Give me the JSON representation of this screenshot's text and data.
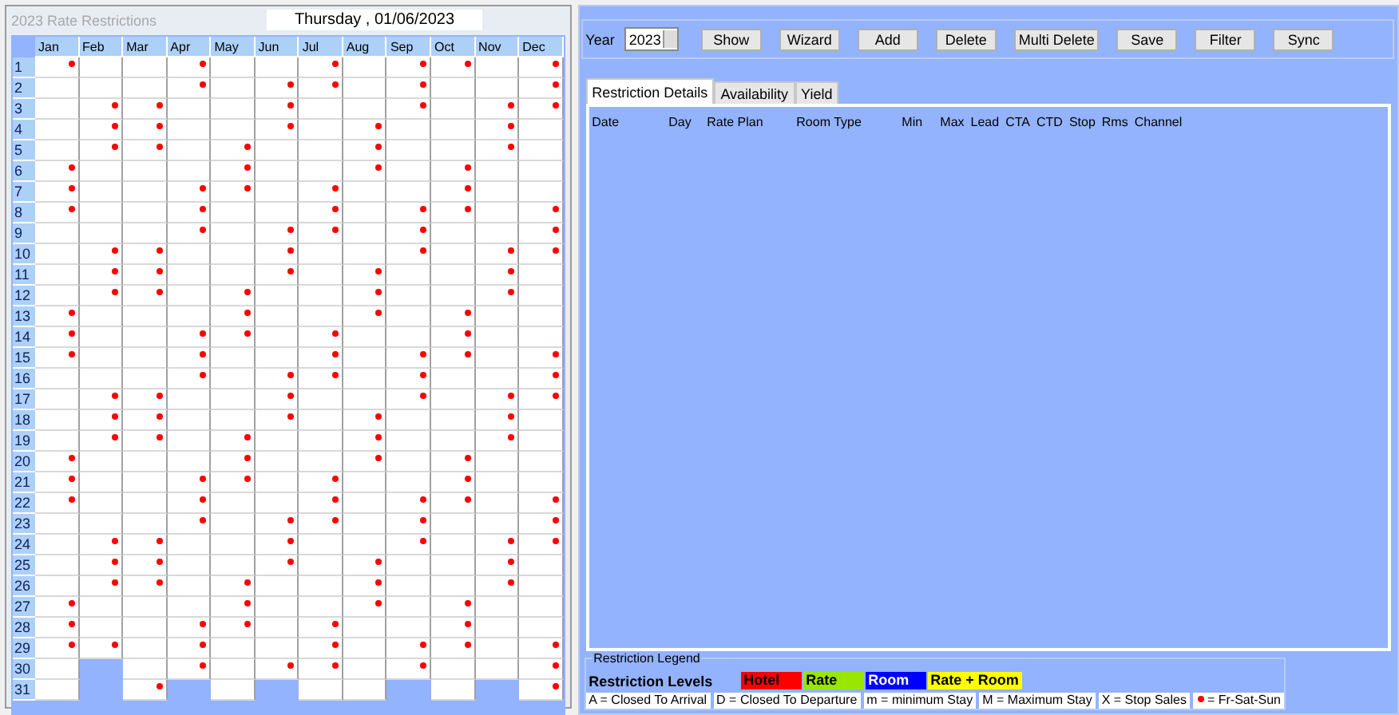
{
  "calendar": {
    "title": "2023 Rate Restrictions",
    "date": "Thursday , 01/06/2023",
    "months": [
      {
        "label": "Jan",
        "dots": [
          true,
          false,
          false,
          false,
          false,
          true,
          true,
          true,
          false,
          false,
          false,
          false,
          true,
          true,
          true,
          false,
          false,
          false,
          false,
          true,
          true,
          true,
          false,
          false,
          false,
          false,
          true,
          true,
          true,
          false,
          false
        ]
      },
      {
        "label": "Feb",
        "dots": [
          false,
          false,
          true,
          true,
          true,
          false,
          false,
          false,
          false,
          true,
          true,
          true,
          false,
          false,
          false,
          false,
          true,
          true,
          true,
          false,
          false,
          false,
          false,
          true,
          true,
          true,
          false,
          false,
          true
        ]
      },
      {
        "label": "Mar",
        "dots": [
          false,
          false,
          true,
          true,
          true,
          false,
          false,
          false,
          false,
          true,
          true,
          true,
          false,
          false,
          false,
          false,
          true,
          true,
          true,
          false,
          false,
          false,
          false,
          true,
          true,
          true,
          false,
          false,
          false,
          false,
          true
        ]
      },
      {
        "label": "Apr",
        "dots": [
          true,
          true,
          false,
          false,
          false,
          false,
          true,
          true,
          true,
          false,
          false,
          false,
          false,
          true,
          true,
          true,
          false,
          false,
          false,
          false,
          true,
          true,
          true,
          false,
          false,
          false,
          false,
          true,
          true,
          true
        ]
      },
      {
        "label": "May",
        "dots": [
          false,
          false,
          false,
          false,
          true,
          true,
          true,
          false,
          false,
          false,
          false,
          true,
          true,
          true,
          false,
          false,
          false,
          false,
          true,
          true,
          true,
          false,
          false,
          false,
          false,
          true,
          true,
          true,
          false,
          false,
          false
        ]
      },
      {
        "label": "Jun",
        "dots": [
          false,
          true,
          true,
          true,
          false,
          false,
          false,
          false,
          true,
          true,
          true,
          false,
          false,
          false,
          false,
          true,
          true,
          true,
          false,
          false,
          false,
          false,
          true,
          true,
          true,
          false,
          false,
          false,
          false,
          true
        ]
      },
      {
        "label": "Jul",
        "dots": [
          true,
          true,
          false,
          false,
          false,
          false,
          true,
          true,
          true,
          false,
          false,
          false,
          false,
          true,
          true,
          true,
          false,
          false,
          false,
          false,
          true,
          true,
          true,
          false,
          false,
          false,
          false,
          true,
          true,
          true,
          false
        ]
      },
      {
        "label": "Aug",
        "dots": [
          false,
          false,
          false,
          true,
          true,
          true,
          false,
          false,
          false,
          false,
          true,
          true,
          true,
          false,
          false,
          false,
          false,
          true,
          true,
          true,
          false,
          false,
          false,
          false,
          true,
          true,
          true,
          false,
          false,
          false,
          false
        ]
      },
      {
        "label": "Sep",
        "dots": [
          true,
          true,
          true,
          false,
          false,
          false,
          false,
          true,
          true,
          true,
          false,
          false,
          false,
          false,
          true,
          true,
          true,
          false,
          false,
          false,
          false,
          true,
          true,
          true,
          false,
          false,
          false,
          false,
          true,
          true
        ]
      },
      {
        "label": "Oct",
        "dots": [
          true,
          false,
          false,
          false,
          false,
          true,
          true,
          true,
          false,
          false,
          false,
          false,
          true,
          true,
          true,
          false,
          false,
          false,
          false,
          true,
          true,
          true,
          false,
          false,
          false,
          false,
          true,
          true,
          true,
          false,
          false
        ]
      },
      {
        "label": "Nov",
        "dots": [
          false,
          false,
          true,
          true,
          true,
          false,
          false,
          false,
          false,
          true,
          true,
          true,
          false,
          false,
          false,
          false,
          true,
          true,
          true,
          false,
          false,
          false,
          false,
          true,
          true,
          true,
          false,
          false,
          false,
          false
        ]
      },
      {
        "label": "Dec",
        "dots": [
          true,
          true,
          true,
          false,
          false,
          false,
          false,
          true,
          true,
          true,
          false,
          false,
          false,
          false,
          true,
          true,
          true,
          false,
          false,
          false,
          false,
          true,
          true,
          true,
          false,
          false,
          false,
          false,
          true,
          true,
          true
        ]
      }
    ],
    "days": [
      "1",
      "2",
      "3",
      "4",
      "5",
      "6",
      "7",
      "8",
      "9",
      "10",
      "11",
      "12",
      "13",
      "14",
      "15",
      "16",
      "17",
      "18",
      "19",
      "20",
      "21",
      "22",
      "23",
      "24",
      "25",
      "26",
      "27",
      "28",
      "29",
      "30",
      "31"
    ]
  },
  "toolbar": {
    "year_label": "Year",
    "year": "2023",
    "buttons": [
      "Show",
      "Wizard",
      "Add",
      "Delete",
      "Multi Delete",
      "Save",
      "Filter",
      "Sync"
    ]
  },
  "tabs": [
    {
      "label": "Restriction Details",
      "selected": true
    },
    {
      "label": "Availability",
      "selected": false
    },
    {
      "label": "Yield",
      "selected": false
    }
  ],
  "table": {
    "columns": [
      "Date",
      "Day",
      "Rate Plan",
      "Room Type",
      "Min",
      "Max",
      "Lead",
      "CTA",
      "CTD",
      "Stop",
      "Rms",
      "Channel"
    ]
  },
  "legend": {
    "title": "Restriction Legend",
    "levels_label": "Restriction Levels",
    "levels": [
      {
        "label": "Hotel",
        "color": "#ff0000"
      },
      {
        "label": "Rate",
        "color": "#99e600"
      },
      {
        "label": "Room",
        "color": "#0000ff"
      },
      {
        "label": "Rate + Room",
        "color": "#ffff00"
      }
    ],
    "codes": [
      {
        "kind": "text",
        "label": "A = Closed To Arrival"
      },
      {
        "kind": "text",
        "label": "D = Closed To Departure"
      },
      {
        "kind": "text",
        "label": "m = minimum Stay"
      },
      {
        "kind": "text",
        "label": "M = Maximum Stay"
      },
      {
        "kind": "text",
        "label": "X = Stop Sales"
      },
      {
        "kind": "dot",
        "label": "= Fr-Sat-Sun"
      }
    ]
  }
}
